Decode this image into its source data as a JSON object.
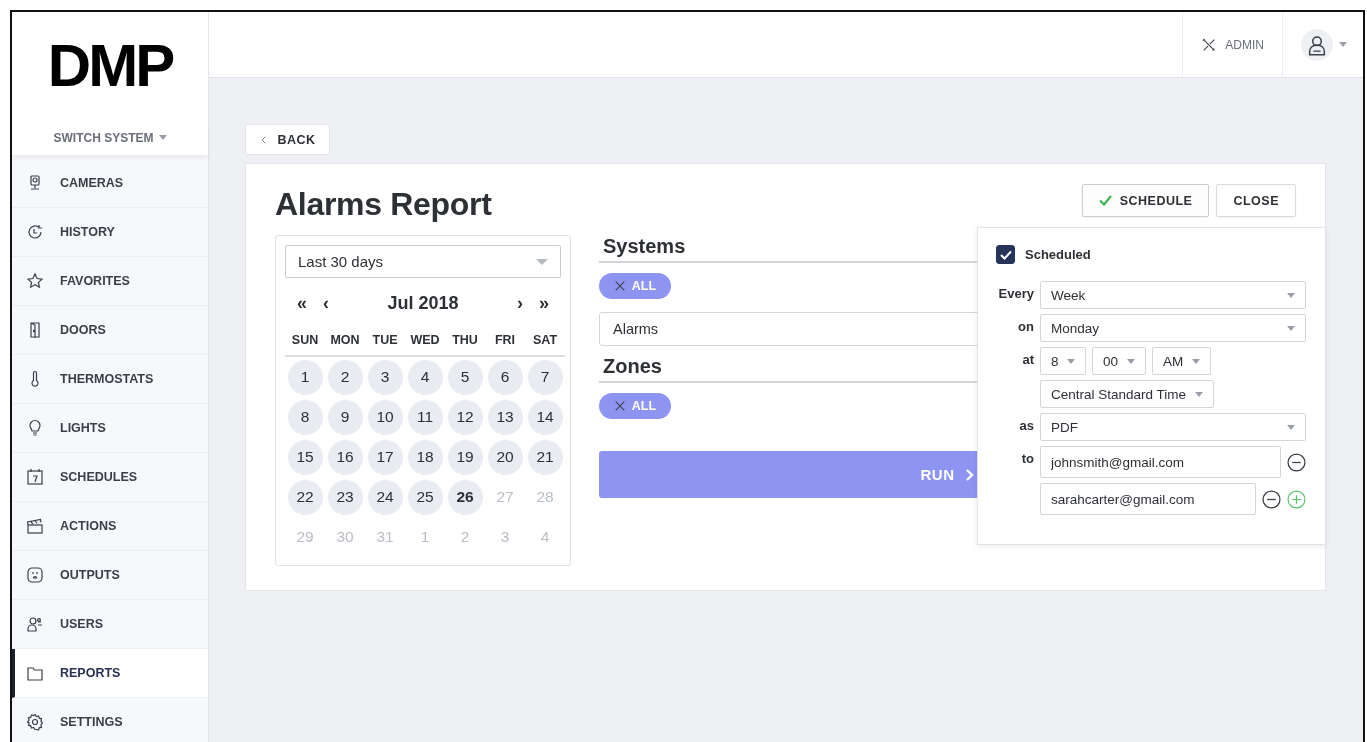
{
  "logo": "DMP",
  "header": {
    "admin": "ADMIN"
  },
  "sidebar": {
    "system_switch": "SWITCH SYSTEM",
    "items": [
      {
        "label": "CAMERAS",
        "selected": false
      },
      {
        "label": "HISTORY",
        "selected": false
      },
      {
        "label": "FAVORITES",
        "selected": false
      },
      {
        "label": "DOORS",
        "selected": false
      },
      {
        "label": "THERMOSTATS",
        "selected": false
      },
      {
        "label": "LIGHTS",
        "selected": false
      },
      {
        "label": "SCHEDULES",
        "selected": false
      },
      {
        "label": "ACTIONS",
        "selected": false
      },
      {
        "label": "OUTPUTS",
        "selected": false
      },
      {
        "label": "USERS",
        "selected": false
      },
      {
        "label": "REPORTS",
        "selected": true
      },
      {
        "label": "SETTINGS",
        "selected": false
      }
    ]
  },
  "back": "BACK",
  "report": {
    "title": "Alarms Report",
    "actions": [
      {
        "label": "SCHEDULE",
        "kind": "schedule",
        "selected": true
      },
      {
        "label": "CLOSE",
        "kind": "close",
        "selected": false
      }
    ],
    "date_range": "Last 30 days",
    "calendar": {
      "month": "Jul 2018",
      "prev": [
        "«",
        "‹"
      ],
      "next": [
        "›",
        "»"
      ],
      "weekdays": [
        "SUN",
        "MON",
        "TUE",
        "WED",
        "THU",
        "FRI",
        "SAT"
      ],
      "days": [
        {
          "day": "1",
          "kind": "available"
        },
        {
          "day": "2",
          "kind": "available"
        },
        {
          "day": "3",
          "kind": "available"
        },
        {
          "day": "4",
          "kind": "available"
        },
        {
          "day": "5",
          "kind": "available"
        },
        {
          "day": "6",
          "kind": "available"
        },
        {
          "day": "7",
          "kind": "available"
        },
        {
          "day": "8",
          "kind": "available"
        },
        {
          "day": "9",
          "kind": "available"
        },
        {
          "day": "10",
          "kind": "available"
        },
        {
          "day": "11",
          "kind": "available"
        },
        {
          "day": "12",
          "kind": "available"
        },
        {
          "day": "13",
          "kind": "available"
        },
        {
          "day": "14",
          "kind": "available"
        },
        {
          "day": "15",
          "kind": "available"
        },
        {
          "day": "16",
          "kind": "available"
        },
        {
          "day": "17",
          "kind": "available"
        },
        {
          "day": "18",
          "kind": "available"
        },
        {
          "day": "19",
          "kind": "available"
        },
        {
          "day": "20",
          "kind": "available"
        },
        {
          "day": "21",
          "kind": "available"
        },
        {
          "day": "22",
          "kind": "available"
        },
        {
          "day": "23",
          "kind": "available"
        },
        {
          "day": "24",
          "kind": "available"
        },
        {
          "day": "25",
          "kind": "available"
        },
        {
          "day": "26",
          "kind": "today"
        },
        {
          "day": "27",
          "kind": "disabled"
        },
        {
          "day": "28",
          "kind": "disabled"
        },
        {
          "day": "29",
          "kind": "disabled"
        },
        {
          "day": "30",
          "kind": "disabled"
        },
        {
          "day": "31",
          "kind": "disabled"
        },
        {
          "day": "1",
          "kind": "disabled"
        },
        {
          "day": "2",
          "kind": "disabled"
        },
        {
          "day": "3",
          "kind": "disabled"
        },
        {
          "day": "4",
          "kind": "disabled"
        }
      ]
    },
    "systems": {
      "heading": "Systems",
      "chip": "ALL",
      "select": "Alarms"
    },
    "zones": {
      "heading": "Zones",
      "chip": "ALL"
    },
    "run": "RUN"
  },
  "schedule": {
    "scheduled": {
      "label": "Scheduled",
      "checked": true
    },
    "every": {
      "label": "Every",
      "value": "Week"
    },
    "on": {
      "label": "on",
      "value": "Monday"
    },
    "at": {
      "label": "at",
      "hour": "8",
      "minute": "00",
      "meridiem": "AM",
      "timezone": "Central Standard Time"
    },
    "as": {
      "label": "as",
      "value": "PDF"
    },
    "to": {
      "label": "to",
      "emails": [
        "johnsmith@gmail.com",
        "sarahcarter@gmail.com"
      ]
    }
  }
}
